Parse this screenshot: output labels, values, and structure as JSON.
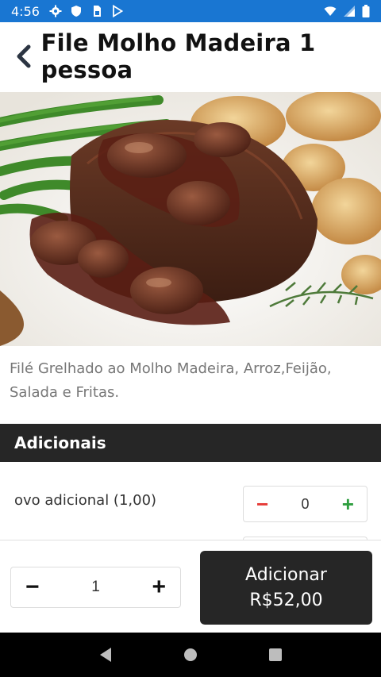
{
  "status_bar": {
    "time": "4:56",
    "left_icons": [
      "gear-icon",
      "shield-icon",
      "sim-card-icon",
      "play-store-icon"
    ],
    "right_icons": [
      "wifi-icon",
      "signal-icon",
      "battery-icon"
    ],
    "color": "#1976d2"
  },
  "header": {
    "back_icon": "chevron-left-icon",
    "title": "File Molho Madeira 1 pessoa"
  },
  "product": {
    "image": "steak-with-mushroom-sauce-photo",
    "description": "Filé Grelhado ao Molho Madeira, Arroz,Feijão, Salada e Fritas."
  },
  "additionals": {
    "section_title": "Adicionais",
    "items": [
      {
        "label": "ovo adicional (1,00)",
        "quantity": "0",
        "minus": "−",
        "plus": "+"
      }
    ]
  },
  "order": {
    "quantity": "1",
    "minus": "−",
    "plus": "+",
    "add_label": "Adicionar",
    "add_price": "R$52,00"
  },
  "nav": {
    "icons": [
      "back-triangle-icon",
      "home-circle-icon",
      "recents-square-icon"
    ]
  },
  "colors": {
    "accent_dark": "#262626",
    "minus_red": "#e53935",
    "plus_green": "#2e9e3f"
  }
}
